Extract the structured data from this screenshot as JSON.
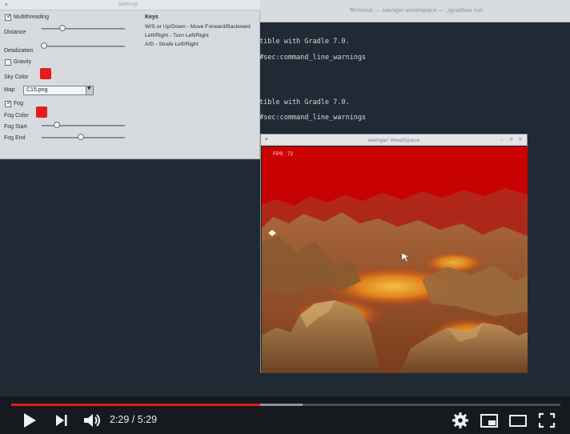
{
  "terminal": {
    "title": "Terminal — swinger-voxelspace — ./gradlew run",
    "lines": [
      "tible with Gradle 7.0.",
      "#sec:command_line_warnings",
      "tible with Gradle 7.0.",
      "#sec:command_line_warnings"
    ]
  },
  "settings": {
    "window_title": "Settings",
    "multithreading_label": "Multithreading",
    "multithreading_checked": true,
    "distance_label": "Distance",
    "distance_value": 0.25,
    "detalization_label": "Detalization",
    "detalization_value": 0.03,
    "gravity_label": "Gravity",
    "gravity_checked": false,
    "sky_color_label": "Sky Color",
    "sky_color": "#e31c1c",
    "map_label": "Map",
    "map_value": "C15.png",
    "fog_label": "Fog",
    "fog_checked": true,
    "fog_color_label": "Fog Color",
    "fog_color": "#e31c1c",
    "fog_start_label": "Fog Start",
    "fog_start_value": 0.18,
    "fog_end_label": "Fog End",
    "fog_end_value": 0.47,
    "keys_title": "Keys",
    "keys": [
      "W/S or Up/Down - Move Forward/Backward",
      "Left/Right - Turn Left/Right",
      "A/D - Strafe Left/Right"
    ]
  },
  "game": {
    "window_title": "swinger VoxelSpace",
    "fps_text": "FPS : 72",
    "sky_color": "#cc0000"
  },
  "player": {
    "time_current": "2:29",
    "time_total": "5:29",
    "time_display": "2:29 / 5:29",
    "played_fraction": 0.453,
    "buffered_fraction": 0.53,
    "accent_color": "#e21b1b",
    "icons": [
      "play-icon",
      "next-icon",
      "volume-icon",
      "settings-icon",
      "miniplayer-icon",
      "theater-icon",
      "fullscreen-icon"
    ]
  }
}
